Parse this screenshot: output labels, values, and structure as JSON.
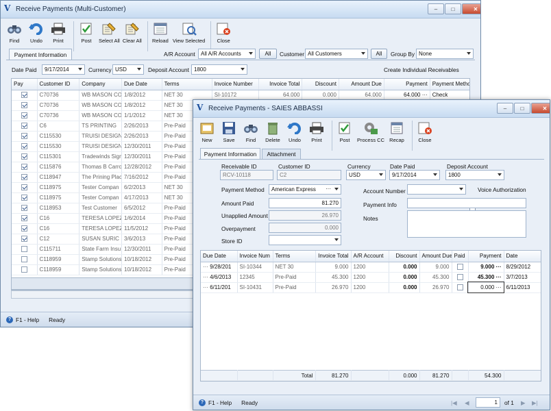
{
  "back": {
    "title": "Receive Payments (Multi-Customer)",
    "toolbar": [
      "Find",
      "Undo",
      "Print",
      "Post",
      "Select All",
      "Clear All",
      "Reload",
      "View Selected",
      "Close"
    ],
    "tab": "Payment Information",
    "ar_label": "A/R Account",
    "ar_value": "All A/R Accounts",
    "all1": "All",
    "customer_label": "Customer",
    "customer_value": "All Customers",
    "all2": "All",
    "groupby_label": "Group By",
    "groupby_value": "None",
    "datepaid_label": "Date Paid",
    "datepaid_value": "9/17/2014",
    "currency_label": "Currency",
    "currency_value": "USD",
    "deposit_label": "Deposit Account",
    "deposit_value": "1800",
    "create_label": "Create Individual Receivables",
    "columns": [
      "Pay",
      "Customer ID",
      "Company",
      "Due Date",
      "Terms",
      "Invoice Number",
      "Invoice Total",
      "Discount",
      "Amount Due",
      "Payment",
      "Payment Method"
    ],
    "rows": [
      {
        "pay": true,
        "cid": "C70736",
        "company": "WB MASON CO",
        "due": "1/8/2012",
        "terms": "NET 30",
        "inv": "SI-10172",
        "total": "64.000",
        "disc": "0.000",
        "amt": "64.000",
        "payment": "64.000",
        "method": "Check"
      },
      {
        "pay": true,
        "cid": "C70736",
        "company": "WB MASON CO",
        "due": "1/8/2012",
        "terms": "NET 30",
        "inv": "",
        "total": "",
        "disc": "",
        "amt": "",
        "payment": "",
        "method": ""
      },
      {
        "pay": true,
        "cid": "C70736",
        "company": "WB MASON CO",
        "due": "1/1/2012",
        "terms": "NET 30",
        "inv": "",
        "total": "",
        "disc": "",
        "amt": "",
        "payment": "",
        "method": ""
      },
      {
        "pay": true,
        "cid": "C6",
        "company": "TS PRINTING",
        "due": "2/26/2013",
        "terms": "Pre-Paid",
        "inv": "",
        "total": "",
        "disc": "",
        "amt": "",
        "payment": "",
        "method": ""
      },
      {
        "pay": true,
        "cid": "C115530",
        "company": "TRUISI DESIGN",
        "due": "2/26/2013",
        "terms": "Pre-Paid",
        "inv": "",
        "total": "",
        "disc": "",
        "amt": "",
        "payment": "",
        "method": ""
      },
      {
        "pay": true,
        "cid": "C115530",
        "company": "TRUISI DESIGN",
        "due": "12/30/2011",
        "terms": "Pre-Paid",
        "inv": "",
        "total": "",
        "disc": "",
        "amt": "",
        "payment": "",
        "method": ""
      },
      {
        "pay": true,
        "cid": "C115301",
        "company": "Tradewinds Sign",
        "due": "12/30/2011",
        "terms": "Pre-Paid",
        "inv": "",
        "total": "",
        "disc": "",
        "amt": "",
        "payment": "",
        "method": ""
      },
      {
        "pay": true,
        "cid": "C115876",
        "company": "Thomas B Carro",
        "due": "12/28/2012",
        "terms": "Pre-Paid",
        "inv": "",
        "total": "",
        "disc": "",
        "amt": "",
        "payment": "",
        "method": ""
      },
      {
        "pay": true,
        "cid": "C118947",
        "company": "The Prining Plac",
        "due": "7/16/2012",
        "terms": "Pre-Paid",
        "inv": "",
        "total": "",
        "disc": "",
        "amt": "",
        "payment": "",
        "method": ""
      },
      {
        "pay": true,
        "cid": "C118975",
        "company": "Tester Compan",
        "due": "6/2/2013",
        "terms": "NET 30",
        "inv": "",
        "total": "",
        "disc": "",
        "amt": "",
        "payment": "",
        "method": ""
      },
      {
        "pay": true,
        "cid": "C118975",
        "company": "Tester Compan",
        "due": "4/17/2013",
        "terms": "NET 30",
        "inv": "",
        "total": "",
        "disc": "",
        "amt": "",
        "payment": "",
        "method": ""
      },
      {
        "pay": true,
        "cid": "C118953",
        "company": "Test Customer",
        "due": "6/5/2012",
        "terms": "Pre-Paid",
        "inv": "",
        "total": "",
        "disc": "",
        "amt": "",
        "payment": "",
        "method": ""
      },
      {
        "pay": true,
        "cid": "C16",
        "company": "TERESA LOPEZ",
        "due": "1/6/2014",
        "terms": "Pre-Paid",
        "inv": "",
        "total": "",
        "disc": "",
        "amt": "",
        "payment": "",
        "method": ""
      },
      {
        "pay": true,
        "cid": "C16",
        "company": "TERESA LOPEZ",
        "due": "11/5/2012",
        "terms": "Pre-Paid",
        "inv": "",
        "total": "",
        "disc": "",
        "amt": "",
        "payment": "",
        "method": ""
      },
      {
        "pay": true,
        "cid": "C12",
        "company": "SUSAN SURIC",
        "due": "3/6/2013",
        "terms": "Pre-Paid",
        "inv": "",
        "total": "",
        "disc": "",
        "amt": "",
        "payment": "",
        "method": ""
      },
      {
        "pay": false,
        "cid": "C115711",
        "company": "State Farm Insu",
        "due": "12/30/2011",
        "terms": "Pre-Paid",
        "inv": "",
        "total": "",
        "disc": "",
        "amt": "",
        "payment": "",
        "method": ""
      },
      {
        "pay": false,
        "cid": "C118959",
        "company": "Stamp Solutions",
        "due": "10/18/2012",
        "terms": "Pre-Paid",
        "inv": "",
        "total": "",
        "disc": "",
        "amt": "",
        "payment": "",
        "method": ""
      },
      {
        "pay": false,
        "cid": "C118959",
        "company": "Stamp Solutions",
        "due": "10/18/2012",
        "terms": "Pre-Paid",
        "inv": "",
        "total": "",
        "disc": "",
        "amt": "",
        "payment": "",
        "method": ""
      }
    ],
    "help": "F1 - Help",
    "status": "Ready"
  },
  "front": {
    "title": "Receive Payments - SAIES ABBASSI",
    "toolbar": [
      "New",
      "Save",
      "Find",
      "Delete",
      "Undo",
      "Print",
      "Post",
      "Process CC",
      "Recap",
      "Close"
    ],
    "tabs": [
      "Payment Information",
      "Attachment"
    ],
    "receivable_label": "Receivable ID",
    "receivable_value": "RCV-10118",
    "customer_label": "Customer ID",
    "customer_value": "C2",
    "currency_label": "Currency",
    "currency_value": "USD",
    "datepaid_label": "Date Paid",
    "datepaid_value": "9/17/2014",
    "deposit_label": "Deposit Account",
    "deposit_value": "1800",
    "method_label": "Payment Method",
    "method_value": "American Express",
    "account_label": "Account Number",
    "voice_label": "Voice Authorization",
    "amountpaid_label": "Amount Paid",
    "amountpaid_value": "81.270",
    "paymentinfo_label": "Payment Info",
    "unapplied_label": "Unapplied Amount",
    "unapplied_value": "26.970",
    "notes_label": "Notes",
    "overpayment_label": "Overpayment",
    "overpayment_value": "0.000",
    "store_label": "Store ID",
    "columns": [
      "Due Date",
      "Invoice Num",
      "Terms",
      "Invoice Total",
      "A/R Account",
      "Discount",
      "Amount Due",
      "Paid",
      "Payment",
      "Date"
    ],
    "rows": [
      {
        "due": "9/28/201",
        "inv": "SI-10344",
        "terms": "NET 30",
        "total": "9.000",
        "ar": "1200",
        "disc": "0.000",
        "amt": "9.000",
        "paid": false,
        "payment": "9.000",
        "date": "8/29/2012"
      },
      {
        "due": "4/6/2013",
        "inv": "12345",
        "terms": "Pre-Paid",
        "total": "45.300",
        "ar": "1200",
        "disc": "0.000",
        "amt": "45.300",
        "paid": false,
        "payment": "45.300",
        "date": "3/7/2013"
      },
      {
        "due": "6/11/201",
        "inv": "SI-10431",
        "terms": "Pre-Paid",
        "total": "26.970",
        "ar": "1200",
        "disc": "0.000",
        "amt": "26.970",
        "paid": false,
        "payment": "0.000",
        "date": "6/11/2013"
      }
    ],
    "totals": {
      "label": "Total",
      "total": "81.270",
      "disc": "0.000",
      "amt": "81.270",
      "payment": "54.300"
    },
    "help": "F1 - Help",
    "status": "Ready",
    "page": "1",
    "of": "of 1"
  }
}
